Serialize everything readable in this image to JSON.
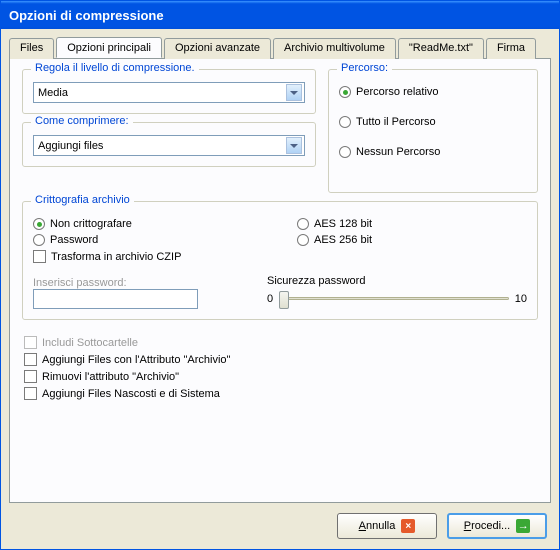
{
  "window": {
    "title": "Opzioni di compressione"
  },
  "tabs": {
    "files": "Files",
    "main": "Opzioni principali",
    "advanced": "Opzioni avanzate",
    "multivol": "Archivio multivolume",
    "readme": "\"ReadMe.txt\"",
    "sign": "Firma"
  },
  "compression": {
    "level_legend": "Regola il livello di compressione.",
    "level_value": "Media",
    "how_legend": "Come comprimere:",
    "how_value": "Aggiungi files"
  },
  "path": {
    "legend": "Percorso:",
    "relative": "Percorso relativo",
    "full": "Tutto il Percorso",
    "none": "Nessun Percorso"
  },
  "crypto": {
    "legend": "Crittografia archivio",
    "none": "Non crittografare",
    "password": "Password",
    "czip": "Trasforma in archivio CZIP",
    "aes128": "AES 128 bit",
    "aes256": "AES 256 bit",
    "pass_label": "Inserisci password:",
    "strength_label": "Sicurezza password",
    "strength_min": "0",
    "strength_max": "10"
  },
  "folders": {
    "include_sub": "Includi Sottocartelle",
    "add_archive_attr": "Aggiungi Files con l'Attributo \"Archivio\"",
    "remove_archive_attr": "Rimuovi l'attributo \"Archivio\"",
    "add_hidden": "Aggiungi Files Nascosti e di Sistema"
  },
  "buttons": {
    "cancel": "Annulla",
    "proceed": "Procedi..."
  }
}
